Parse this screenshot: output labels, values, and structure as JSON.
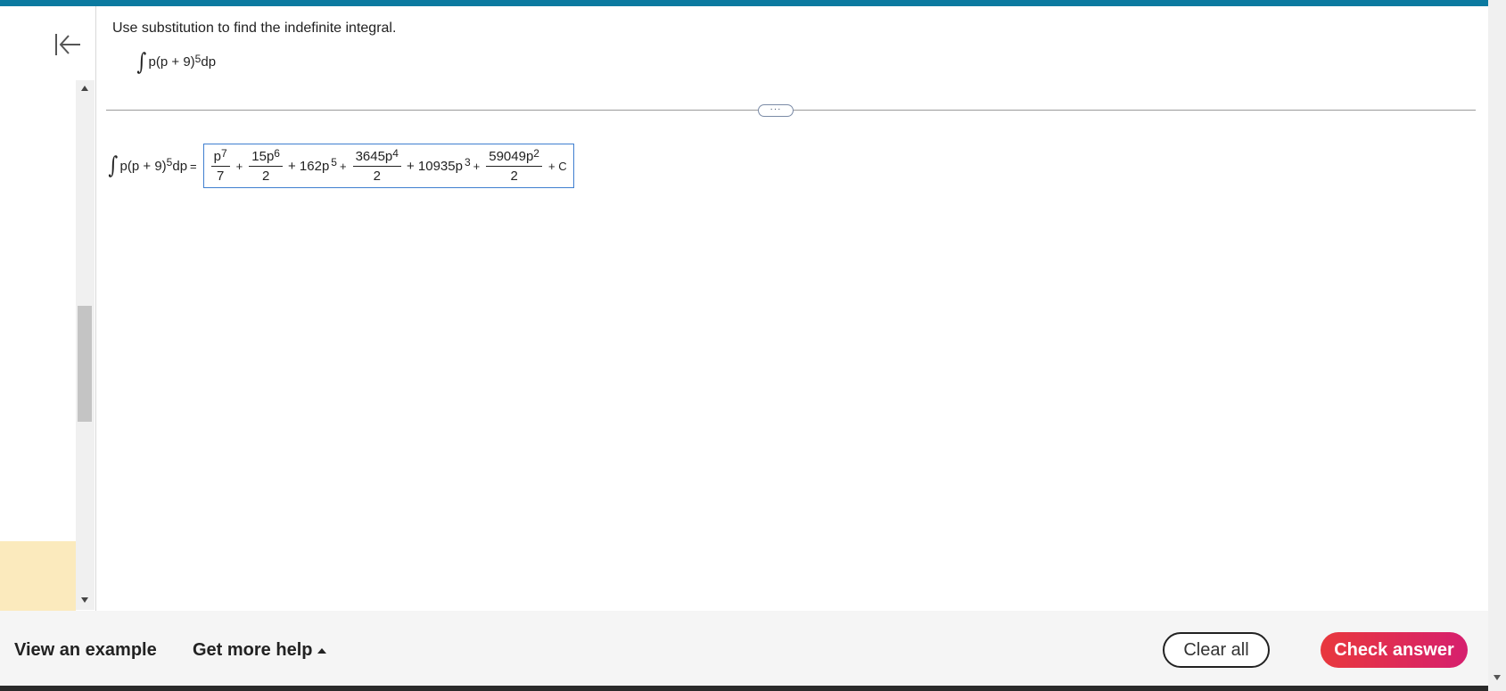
{
  "question": {
    "instruction": "Use substitution to find the indefinite integral.",
    "integrand": "p(p + 9)",
    "exponent": "5",
    "differential": "dp"
  },
  "answer": {
    "lhs_integrand": "p(p + 9)",
    "lhs_exponent": "5",
    "lhs_differential": "dp",
    "equals": "=",
    "terms": {
      "t1_num_base": "p",
      "t1_num_exp": "7",
      "t1_den": "7",
      "plus1": "+",
      "t2_num_base": "15p",
      "t2_num_exp": "6",
      "t2_den": "2",
      "plus2": "+ 162p",
      "t3_exp": "5",
      "plus3": "+",
      "t4_num_base": "3645p",
      "t4_num_exp": "4",
      "t4_den": "2",
      "plus4": "+ 10935p",
      "t5_exp": "3",
      "plus5": "+",
      "t6_num_base": "59049p",
      "t6_num_exp": "2",
      "t6_den": "2",
      "constant": "+ C"
    }
  },
  "divider_button": "···",
  "footer": {
    "view_example": "View an example",
    "get_more_help": "Get more help",
    "clear_all": "Clear all",
    "check_answer": "Check answer"
  },
  "icons": {
    "collapse": "collapse-left-icon",
    "integral": "integral-sign-icon",
    "help_caret": "caret-up-icon"
  },
  "colors": {
    "top_bar": "#0b7aa0",
    "check_answer_start": "#e8383d",
    "check_answer_end": "#d61f6e",
    "answer_box_border": "#3f7fd0",
    "sidebar_highlight": "#fbeabd"
  }
}
